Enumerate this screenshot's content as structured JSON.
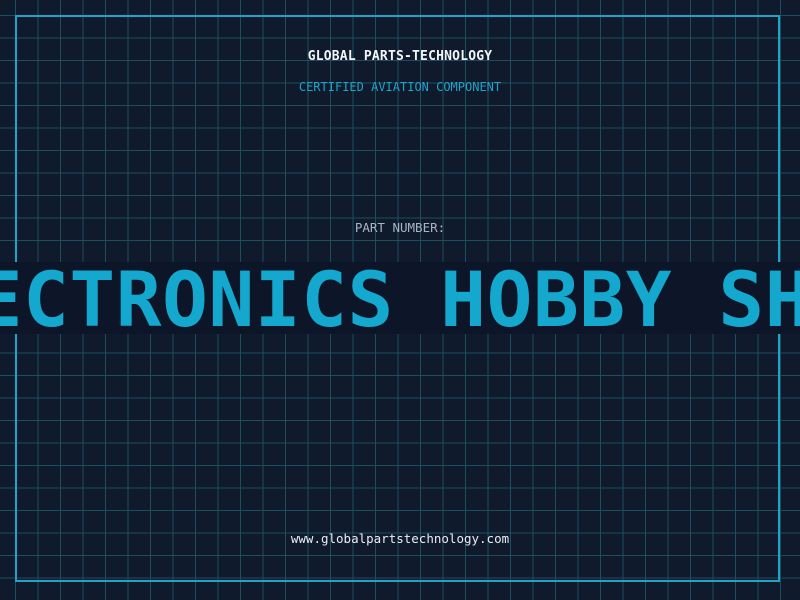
{
  "header": {
    "company": "GLOBAL PARTS-TECHNOLOGY",
    "subtitle": "CERTIFIED AVIATION COMPONENT"
  },
  "part": {
    "label": "PART NUMBER:",
    "value": "ELECTRONICS HOBBY SHOP"
  },
  "footer": {
    "url": "www.globalpartstechnology.com"
  },
  "colors": {
    "background": "#101a2d",
    "grid": "#1e4e5e",
    "accent": "#1fa3c9",
    "banner_text": "#14a8cf"
  }
}
